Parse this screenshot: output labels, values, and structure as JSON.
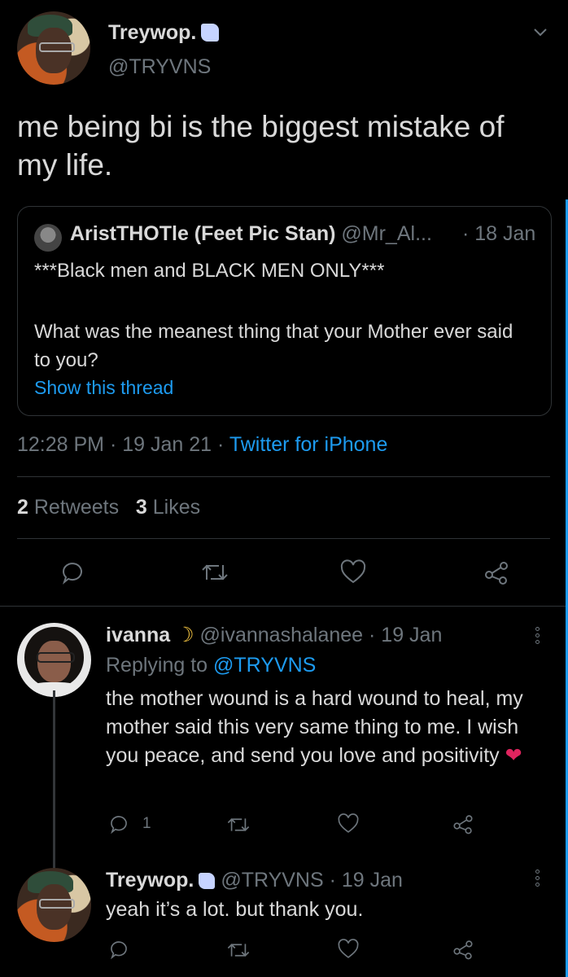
{
  "main_tweet": {
    "author_name": "Treywop.",
    "author_handle": "@TRYVNS",
    "text": "me being bi is the biggest mistake of my life.",
    "time": "12:28 PM",
    "date": "19 Jan 21",
    "source": "Twitter for iPhone",
    "retweets_count": "2",
    "retweets_label": "Retweets",
    "likes_count": "3",
    "likes_label": "Likes",
    "menu_icon": "chevron-down-icon"
  },
  "quoted_tweet": {
    "author_name": "AristTHOTle (Feet Pic Stan)",
    "author_handle": "@Mr_Al...",
    "date": "· 18 Jan",
    "line1": "***Black men and BLACK MEN ONLY***",
    "line2": "What was the meanest thing that your Mother ever said to you?",
    "show_thread": "Show this thread"
  },
  "reply1": {
    "author_name": "ivanna",
    "author_handle": "@ivannashalanee",
    "date": "· 19 Jan",
    "replying_prefix": "Replying to",
    "replying_to": "@TRYVNS",
    "text": "the mother wound is a hard wound to heal, my mother said this very same thing to me. I wish you peace, and send you love and positivity",
    "reply_count": "1"
  },
  "reply2": {
    "author_name": "Treywop.",
    "author_handle": "@TRYVNS",
    "date": "· 19 Jan",
    "text": "yeah it’s a lot. but thank you."
  },
  "colors": {
    "background": "#000000",
    "text": "#d9d9d9",
    "muted": "#6e767d",
    "accent": "#1d9bf0",
    "heart": "#e0245e"
  }
}
